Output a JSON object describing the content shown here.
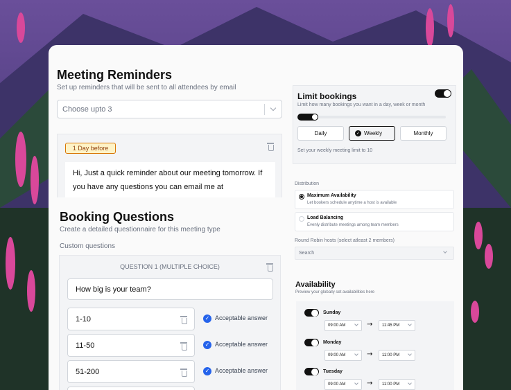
{
  "colors": {
    "accent": "#2563eb",
    "badge_bg": "#fef3c7",
    "badge_border": "#d97706",
    "toggle": "#111111"
  },
  "reminders": {
    "title": "Meeting Reminders",
    "subtitle": "Set up reminders that will be sent to all attendees by email",
    "select_placeholder": "Choose upto 3",
    "badge": "1 Day before",
    "message_lines": [
      "Hi, Just a quick reminder about our meeting tomorrow. If",
      "you have any questions you can email me at"
    ]
  },
  "booking": {
    "title": "Booking Questions",
    "subtitle": "Create a detailed questionnaire for this meeting type",
    "custom_label": "Custom questions",
    "question_header": "QUESTION 1 (MULTIPLE CHOICE)",
    "question_text": "How big is your team?",
    "answers": [
      {
        "value": "1-10",
        "label": "Acceptable answer"
      },
      {
        "value": "11-50",
        "label": "Acceptable answer"
      },
      {
        "value": "51-200",
        "label": "Acceptable answer"
      }
    ]
  },
  "limit": {
    "title": "Limit bookings",
    "subtitle": "Limit how many bookings you want in a day, week or month",
    "options": [
      "Daily",
      "Weekly",
      "Monthly"
    ],
    "selected": "Weekly",
    "note": "Set your weekly meeting limit to 10"
  },
  "distribution": {
    "label": "Distribution",
    "options": [
      {
        "title": "Maximum Availability",
        "desc": "Let bookers schedule anytime a host is available",
        "selected": true
      },
      {
        "title": "Load Balancing",
        "desc": "Evenly distribute meetings among team members",
        "selected": false
      }
    ],
    "hosts_label": "Round Robin hosts (select atleast 2 members)",
    "search_placeholder": "Search"
  },
  "availability": {
    "title": "Availability",
    "subtitle": "Preview your globally set availabilities here",
    "days": [
      {
        "day": "Sunday",
        "from": "09:00 AM",
        "to": "11:45 PM"
      },
      {
        "day": "Monday",
        "from": "09:00 AM",
        "to": "11:00 PM"
      },
      {
        "day": "Tuesday",
        "from": "09:00 AM",
        "to": "11:00 PM"
      }
    ],
    "arrow": "→"
  }
}
